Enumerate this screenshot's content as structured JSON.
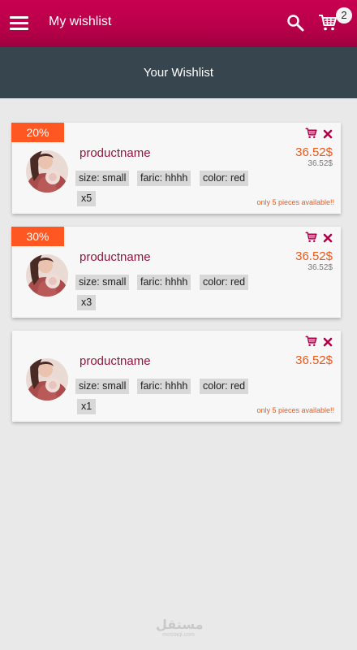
{
  "appbar": {
    "title": "My wishlist",
    "cart_count": "2",
    "menu_icon": "hamburger-menu-icon",
    "search_icon": "search-icon",
    "cart_icon": "shopping-cart-icon"
  },
  "subheader": {
    "title": "Your Wishlist"
  },
  "items": [
    {
      "discount": "20%",
      "name": "productname",
      "price": "36.52$",
      "old_price": "36.52$",
      "size": "size: small",
      "fabric": "faric: hhhh",
      "color": "color: red",
      "quantity": "x5",
      "availability": "only 5 pieces available!!"
    },
    {
      "discount": "30%",
      "name": "productname",
      "price": "36.52$",
      "old_price": "36.52$",
      "size": "size: small",
      "fabric": "faric: hhhh",
      "color": "color: red",
      "quantity": "x3",
      "availability": ""
    },
    {
      "discount": "",
      "name": "productname",
      "price": "36.52$",
      "old_price": "",
      "size": "size: small",
      "fabric": "faric: hhhh",
      "color": "color: red",
      "quantity": "x1",
      "availability": "only 5 pieces available!!"
    }
  ],
  "watermark": {
    "arabic": "مستقل",
    "latin": "mostaql.com"
  },
  "colors": {
    "appbar": "#b8004a",
    "subheader": "#37454f",
    "discount": "#ff5722",
    "price": "#e85a1b",
    "product_name": "#8c1a3c",
    "background": "#e9e9e9"
  }
}
